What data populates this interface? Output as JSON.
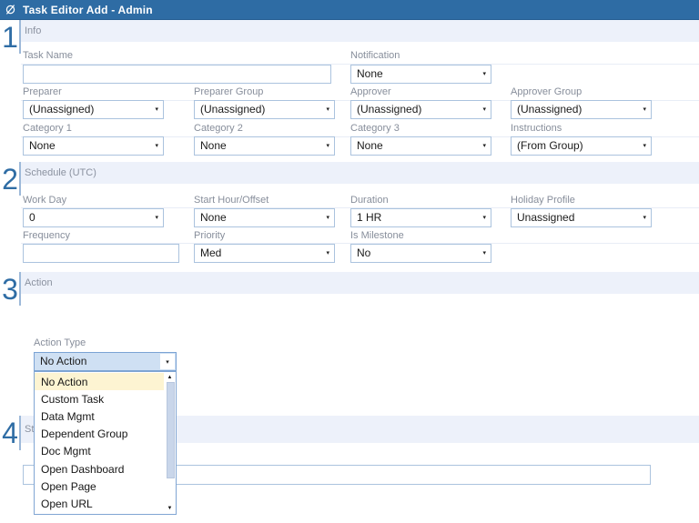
{
  "titlebar": {
    "title": "Task Editor Add - Admin",
    "logo_icon": "empty-set-logo"
  },
  "icons": {
    "chevron_down": "▾",
    "scroll_up": "▲",
    "scroll_down": "▼"
  },
  "colors": {
    "titlebar_blue": "#2e6ca4",
    "section_accent_blue": "#2f6da5",
    "section_band": "#edf1fa",
    "selected_combo_bg": "#cfe0f3",
    "highlighted_option_bg": "#fdf4d2"
  },
  "sections": {
    "info": {
      "number": "1",
      "title": "Info"
    },
    "schedule": {
      "number": "2",
      "title": "Schedule (UTC)"
    },
    "action": {
      "number": "3",
      "title": "Action"
    },
    "status": {
      "number": "4",
      "title": "Status"
    }
  },
  "info": {
    "task_name": {
      "label": "Task Name",
      "value": ""
    },
    "notification": {
      "label": "Notification",
      "value": "None"
    },
    "preparer": {
      "label": "Preparer",
      "value": "(Unassigned)"
    },
    "preparer_group": {
      "label": "Preparer Group",
      "value": "(Unassigned)"
    },
    "approver": {
      "label": "Approver",
      "value": "(Unassigned)"
    },
    "approver_group": {
      "label": "Approver Group",
      "value": "(Unassigned)"
    },
    "category1": {
      "label": "Category 1",
      "value": "None"
    },
    "category2": {
      "label": "Category 2",
      "value": "None"
    },
    "category3": {
      "label": "Category 3",
      "value": "None"
    },
    "instructions": {
      "label": "Instructions",
      "value": "(From Group)"
    }
  },
  "schedule": {
    "work_day": {
      "label": "Work Day",
      "value": "0"
    },
    "start_hour_offset": {
      "label": "Start Hour/Offset",
      "value": "None"
    },
    "duration": {
      "label": "Duration",
      "value": "1 HR"
    },
    "holiday_profile": {
      "label": "Holiday Profile",
      "value": "Unassigned"
    },
    "frequency": {
      "label": "Frequency",
      "value": ""
    },
    "priority": {
      "label": "Priority",
      "value": "Med"
    },
    "is_milestone": {
      "label": "Is Milestone",
      "value": "No"
    }
  },
  "action": {
    "action_type": {
      "label": "Action Type",
      "value": "No Action",
      "highlighted": "No Action",
      "options": [
        "No Action",
        "Custom Task",
        "Data Mgmt",
        "Dependent Group",
        "Doc Mgmt",
        "Open Dashboard",
        "Open Page",
        "Open URL"
      ]
    }
  },
  "status": {
    "value": ""
  }
}
